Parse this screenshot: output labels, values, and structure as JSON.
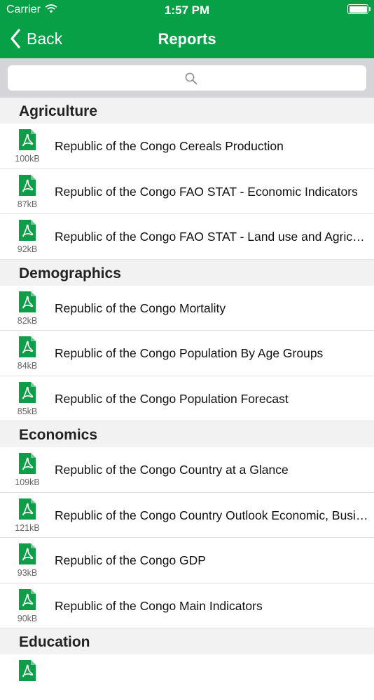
{
  "status_bar": {
    "carrier": "Carrier",
    "time": "1:57 PM"
  },
  "nav": {
    "back_label": "Back",
    "title": "Reports"
  },
  "search": {
    "placeholder": ""
  },
  "colors": {
    "brand_green": "#08a047",
    "section_bg": "#f2f2f2",
    "search_bar_bg": "#d5d5d9"
  },
  "sections": [
    {
      "title": "Agriculture",
      "items": [
        {
          "title": "Republic of the Congo Cereals Production",
          "size": "100kB",
          "icon": "pdf-file-icon"
        },
        {
          "title": "Republic of the Congo FAO STAT - Economic Indicators",
          "size": "87kB",
          "icon": "pdf-file-icon"
        },
        {
          "title": "Republic of the Congo FAO STAT - Land use and Agriculture",
          "size": "92kB",
          "icon": "pdf-file-icon"
        }
      ]
    },
    {
      "title": "Demographics",
      "items": [
        {
          "title": "Republic of the Congo Mortality",
          "size": "82kB",
          "icon": "pdf-file-icon"
        },
        {
          "title": "Republic of the Congo Population By Age Groups",
          "size": "84kB",
          "icon": "pdf-file-icon"
        },
        {
          "title": "Republic of the Congo Population Forecast",
          "size": "85kB",
          "icon": "pdf-file-icon"
        }
      ]
    },
    {
      "title": "Economics",
      "items": [
        {
          "title": "Republic of the Congo Country at a Glance",
          "size": "109kB",
          "icon": "pdf-file-icon"
        },
        {
          "title": "Republic of the Congo Country Outlook Economic, Business",
          "size": "121kB",
          "icon": "pdf-file-icon"
        },
        {
          "title": "Republic of the Congo GDP",
          "size": "93kB",
          "icon": "pdf-file-icon"
        },
        {
          "title": "Republic of the Congo Main Indicators",
          "size": "90kB",
          "icon": "pdf-file-icon"
        }
      ]
    },
    {
      "title": "Education",
      "items": [
        {
          "title": "",
          "size": "",
          "icon": "pdf-file-icon"
        }
      ]
    }
  ]
}
